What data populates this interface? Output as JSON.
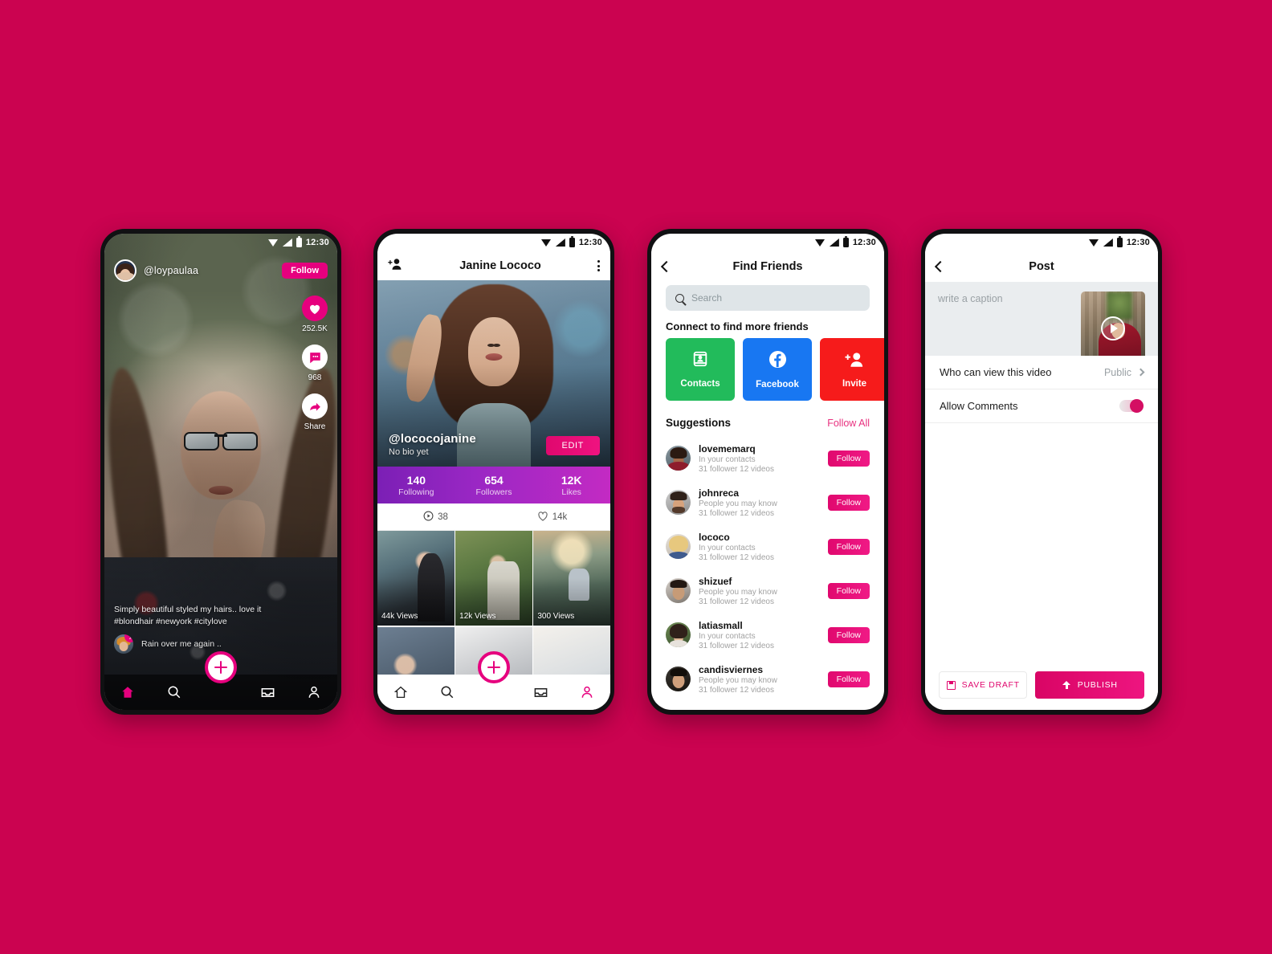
{
  "background_color": "#cb0350",
  "accent_color": "#e6007e",
  "status_bar": {
    "time": "12:30",
    "icons": [
      "wifi-icon",
      "signal-icon",
      "battery-icon"
    ]
  },
  "feed_screen": {
    "handle": "@loypaulaa",
    "follow_label": "Follow",
    "actions": [
      {
        "icon": "heart-icon",
        "count": "252.5K"
      },
      {
        "icon": "comment-icon",
        "count": "968"
      },
      {
        "icon": "share-icon",
        "count": "Share"
      }
    ],
    "caption_line1": "Simply beautiful styled my hairs.. love it",
    "caption_line2": "#blondhair #newyork #citylove",
    "music_title": "Rain over me again ..",
    "nav": [
      "home-icon",
      "search-icon",
      "create-icon",
      "inbox-icon",
      "profile-icon"
    ]
  },
  "profile_screen": {
    "title": "Janine Lococo",
    "add_friend_icon": "add-person-icon",
    "more_icon": "more-vertical-icon",
    "handle": "@lococojanine",
    "bio": "No bio yet",
    "edit_label": "EDIT",
    "stats": [
      {
        "value": "140",
        "label": "Following"
      },
      {
        "value": "654",
        "label": "Followers"
      },
      {
        "value": "12K",
        "label": "Likes"
      }
    ],
    "metrics": [
      {
        "icon": "play-circle-icon",
        "value": "38"
      },
      {
        "icon": "heart-outline-icon",
        "value": "14k"
      }
    ],
    "grid": [
      {
        "views": "44k Views"
      },
      {
        "views": "12k Views"
      },
      {
        "views": "300 Views"
      },
      {
        "views": ""
      },
      {
        "views": ""
      },
      {
        "views": ""
      }
    ]
  },
  "find_friends_screen": {
    "title": "Find Friends",
    "back_icon": "back-chevron-icon",
    "search_placeholder": "Search",
    "search_value": "",
    "connect_title": "Connect to find more friends",
    "connect_buttons": [
      {
        "label": "Contacts",
        "color": "#22bb5b",
        "icon": "contacts-card-icon"
      },
      {
        "label": "Facebook",
        "color": "#1877f2",
        "icon": "facebook-icon"
      },
      {
        "label": "Invite",
        "color": "#f61b1b",
        "icon": "add-person-icon"
      }
    ],
    "suggestions_title": "Suggestions",
    "follow_all_label": "Follow All",
    "follow_label": "Follow",
    "suggestions": [
      {
        "name": "lovememarq",
        "relation": "In your contacts",
        "stats": "31 follower   12 videos"
      },
      {
        "name": "johnreca",
        "relation": "People you may know",
        "stats": "31 follower   12 videos"
      },
      {
        "name": "lococo",
        "relation": "In your contacts",
        "stats": "31 follower   12 videos"
      },
      {
        "name": "shizuef",
        "relation": "People you may know",
        "stats": "31 follower   12 videos"
      },
      {
        "name": "latiasmall",
        "relation": "In your contacts",
        "stats": "31 follower   12 videos"
      },
      {
        "name": "candisviernes",
        "relation": "People you may know",
        "stats": "31 follower   12 videos"
      }
    ]
  },
  "post_screen": {
    "title": "Post",
    "back_icon": "back-chevron-icon",
    "caption_placeholder": "write a caption",
    "caption_value": "",
    "thumbnail_icon": "play-icon",
    "privacy_label": "Who can view this video",
    "privacy_value": "Public",
    "comments_label": "Allow Comments",
    "comments_enabled": "on",
    "save_draft_label": "SAVE DRAFT",
    "publish_label": "PUBLISH"
  }
}
